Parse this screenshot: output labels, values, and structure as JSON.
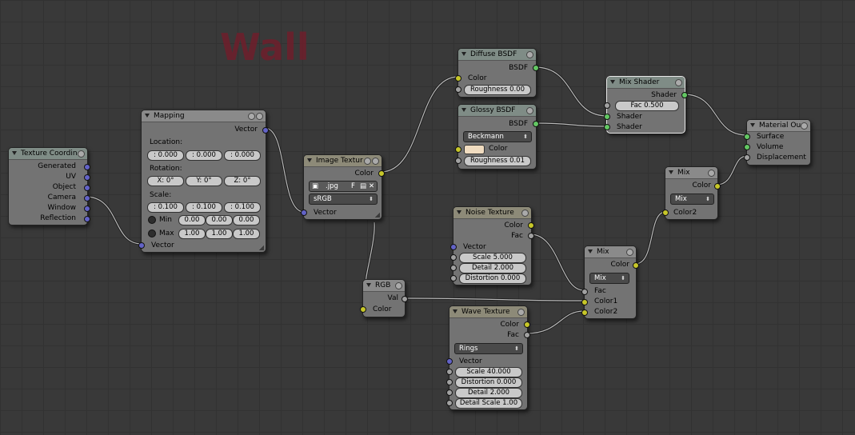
{
  "annotation": "Wall",
  "nodes": {
    "tex_coord": {
      "title": "Texture Coordin",
      "outputs": [
        "Generated",
        "UV",
        "Object",
        "Camera",
        "Window",
        "Reflection"
      ]
    },
    "mapping": {
      "title": "Mapping",
      "out": "Vector",
      "location_label": "Location:",
      "location": [
        ": 0.000",
        ": 0.000",
        ": 0.000"
      ],
      "rotation_label": "Rotation:",
      "rotation": [
        "X: 0°",
        "Y: 0°",
        "Z: 0°"
      ],
      "scale_label": "Scale:",
      "scale": [
        ": 0.100",
        ": 0.100",
        ": 0.100"
      ],
      "min_label": "Min",
      "min": [
        "0.00",
        "0.00",
        "0.00"
      ],
      "max_label": "Max",
      "max": [
        "1.00",
        "1.00",
        "1.00"
      ],
      "in": "Vector"
    },
    "image_tex": {
      "title": "Image Textur",
      "out": "Color",
      "file": ".jpg",
      "f": "F",
      "colorspace": "sRGB",
      "in": "Vector"
    },
    "rgb": {
      "title": "RGB",
      "out": "Val",
      "in": "Color"
    },
    "diffuse": {
      "title": "Diffuse BSDF",
      "out": "BSDF",
      "color": "Color",
      "roughness": "Roughness 0.00"
    },
    "glossy": {
      "title": "Glossy BSDF",
      "out": "BSDF",
      "dist": "Beckmann",
      "color": "Color",
      "roughness": "Roughness 0.01"
    },
    "mix_shader": {
      "title": "Mix Shader",
      "out": "Shader",
      "fac": "Fac 0.500",
      "in1": "Shader",
      "in2": "Shader"
    },
    "material": {
      "title": "Material Ou",
      "in": [
        "Surface",
        "Volume",
        "Displacement"
      ]
    },
    "noise": {
      "title": "Noise Texture",
      "out1": "Color",
      "out2": "Fac",
      "in": "Vector",
      "scale": "Scale 5.000",
      "detail": "Detail 2.000",
      "distortion": "Distortion 0.000"
    },
    "wave": {
      "title": "Wave Texture",
      "out1": "Color",
      "out2": "Fac",
      "type": "Rings",
      "in": "Vector",
      "scale": "Scale 40.000",
      "distortion": "Distortion 0.000",
      "detail": "Detail 2.000",
      "detail_scale": "Detail Scale 1.00"
    },
    "mix1": {
      "title": "Mix",
      "out": "Color",
      "mode": "Mix",
      "fac": "Fac",
      "c1": "Color1",
      "c2": "Color2"
    },
    "mix2": {
      "title": "Mix",
      "out": "Color",
      "mode": "Mix",
      "c2": "Color2"
    }
  },
  "colors": {
    "background": "#393939",
    "node": "#737373",
    "socket_color": "#c7c729",
    "socket_shader": "#63c763",
    "socket_vector": "#6363c7",
    "socket_value": "#a1a1a1",
    "annotation": "#6e1f2c"
  }
}
